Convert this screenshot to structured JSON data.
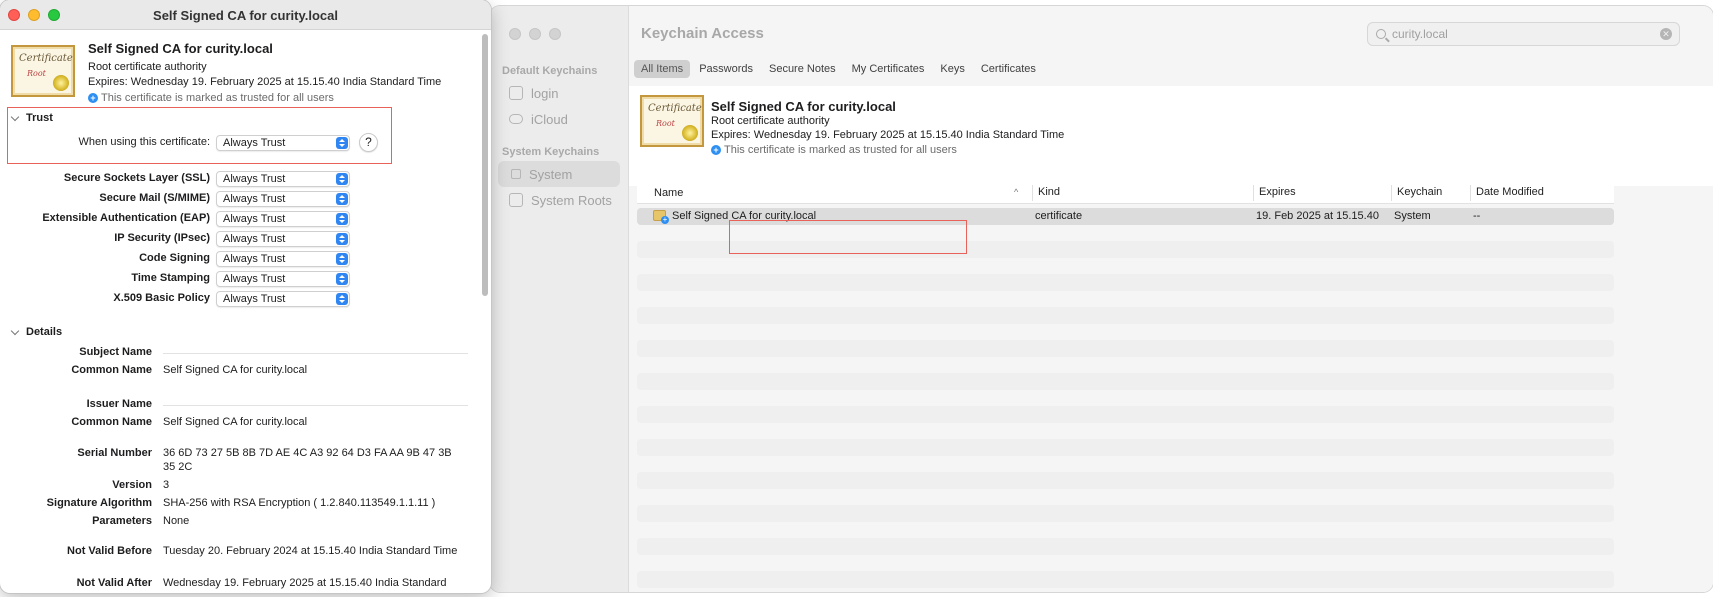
{
  "keychain": {
    "title": "Keychain Access",
    "sidebar": {
      "default_group": "Default Keychains",
      "default_items": [
        "login",
        "iCloud"
      ],
      "system_group": "System Keychains",
      "system_items": [
        "System",
        "System Roots"
      ]
    },
    "search": {
      "value": "curity.local"
    },
    "category_tabs": [
      "All Items",
      "Passwords",
      "Secure Notes",
      "My Certificates",
      "Keys",
      "Certificates"
    ],
    "selected_tab": "All Items",
    "cert_header": {
      "name": "Self Signed CA for curity.local",
      "subtitle": "Root certificate authority",
      "expires": "Expires: Wednesday 19. February 2025 at 15.15.40 India Standard Time",
      "trust_note": "This certificate is marked as trusted for all users"
    },
    "table": {
      "columns": [
        "Name",
        "Kind",
        "Expires",
        "Keychain",
        "Date Modified"
      ],
      "rows": [
        {
          "name": "Self Signed CA for curity.local",
          "kind": "certificate",
          "expires": "19. Feb 2025 at 15.15.40",
          "keychain": "System",
          "modified": "--"
        }
      ]
    }
  },
  "cert_window": {
    "title": "Self Signed CA for curity.local",
    "icon_text_1": "Certificate",
    "icon_text_2": "Root",
    "header": {
      "name": "Self Signed CA for curity.local",
      "subtitle": "Root certificate authority",
      "expires": "Expires: Wednesday 19. February 2025 at 15.15.40 India Standard Time",
      "trust_note": "This certificate is marked as trusted for all users"
    },
    "trust": {
      "section_label": "Trust",
      "when_using_label": "When using this certificate:",
      "when_using_value": "Always Trust",
      "help_label": "?",
      "settings": [
        {
          "label": "Secure Sockets Layer (SSL)",
          "value": "Always Trust"
        },
        {
          "label": "Secure Mail (S/MIME)",
          "value": "Always Trust"
        },
        {
          "label": "Extensible Authentication (EAP)",
          "value": "Always Trust"
        },
        {
          "label": "IP Security (IPsec)",
          "value": "Always Trust"
        },
        {
          "label": "Code Signing",
          "value": "Always Trust"
        },
        {
          "label": "Time Stamping",
          "value": "Always Trust"
        },
        {
          "label": "X.509 Basic Policy",
          "value": "Always Trust"
        }
      ]
    },
    "details": {
      "section_label": "Details",
      "subject_name_label": "Subject Name",
      "subject_cn_label": "Common Name",
      "subject_cn_value": "Self Signed CA for curity.local",
      "issuer_name_label": "Issuer Name",
      "issuer_cn_label": "Common Name",
      "issuer_cn_value": "Self Signed CA for curity.local",
      "serial_label": "Serial Number",
      "serial_value": "36 6D 73 27 5B 8B 7D AE 4C A3 92 64 D3 FA AA 9B 47 3B 35 2C",
      "version_label": "Version",
      "version_value": "3",
      "sigalg_label": "Signature Algorithm",
      "sigalg_value": "SHA-256 with RSA Encryption ( 1.2.840.113549.1.1.11 )",
      "params_label": "Parameters",
      "params_value": "None",
      "not_before_label": "Not Valid Before",
      "not_before_value": "Tuesday 20. February 2024 at 15.15.40 India Standard Time",
      "not_after_label": "Not Valid After",
      "not_after_value": "Wednesday 19. February 2025 at 15.15.40 India Standard"
    }
  }
}
